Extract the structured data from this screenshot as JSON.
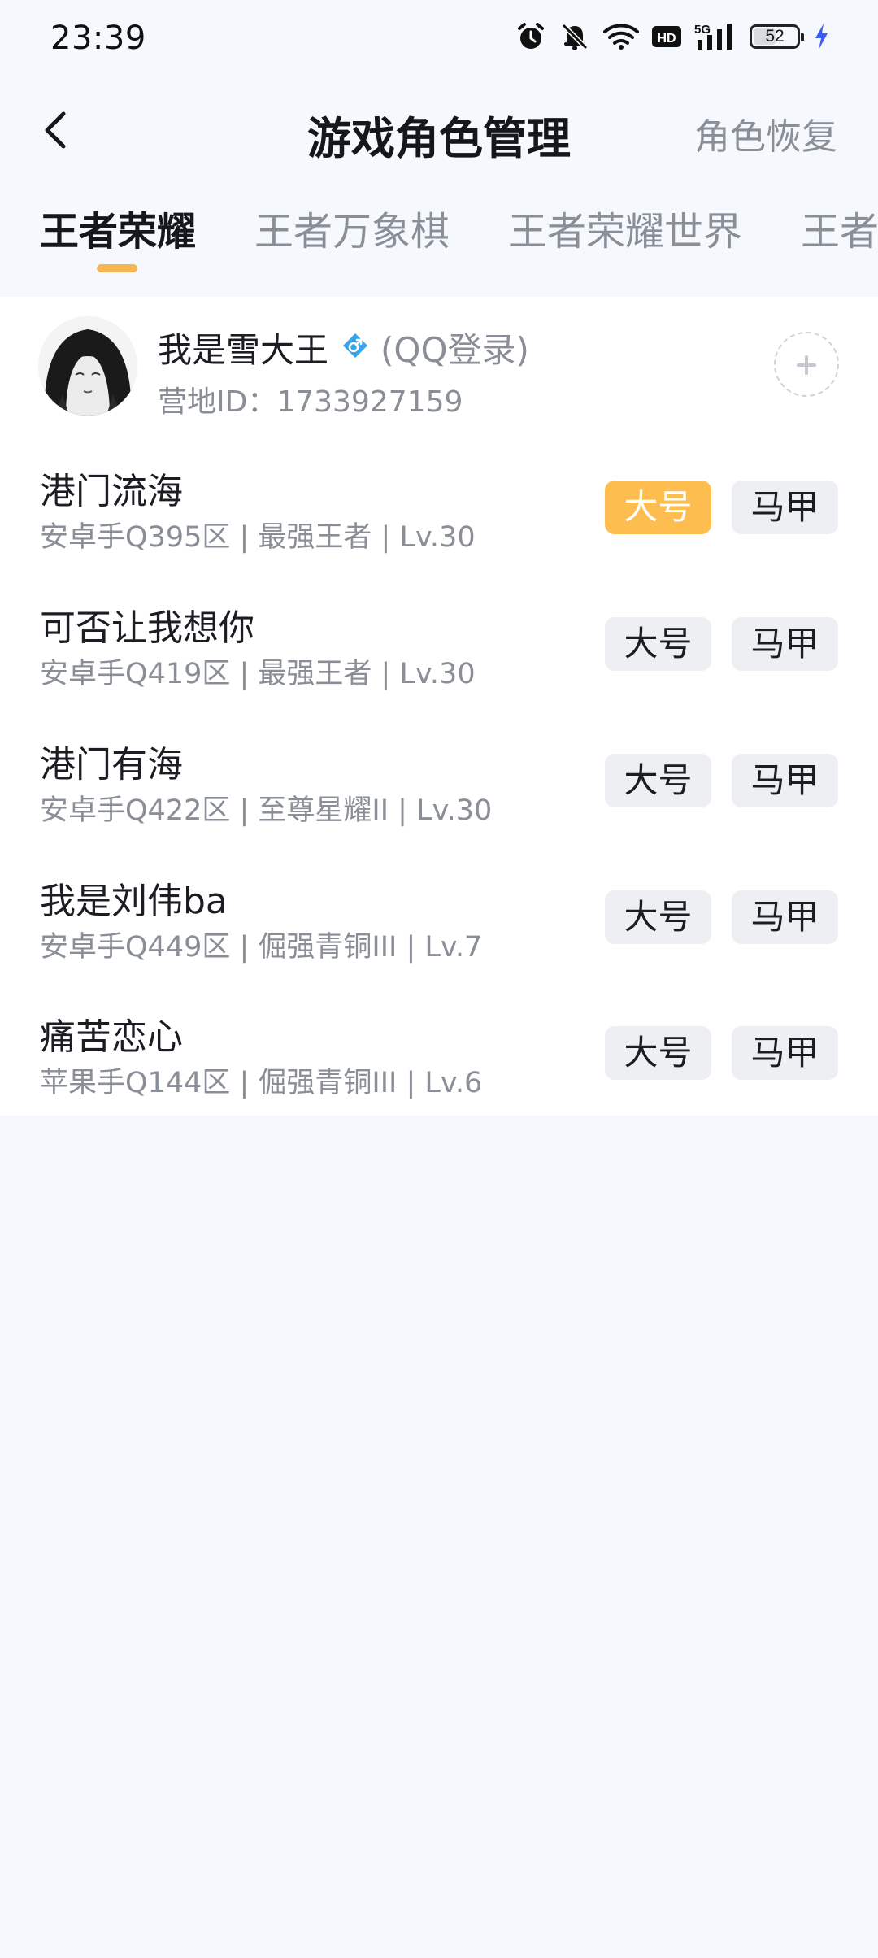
{
  "status_bar": {
    "time": "23:39",
    "icons": [
      "alarm-icon",
      "bell-muted-icon",
      "wifi-icon",
      "hd-icon",
      "5g-signal-icon",
      "battery-icon",
      "charging-bolt-icon"
    ],
    "network_label": "5G",
    "hd_label": "HD",
    "battery_level": 52,
    "battery_text": "52"
  },
  "header": {
    "back_icon": "chevron-left-icon",
    "title": "游戏角色管理",
    "restore_label": "角色恢复"
  },
  "tabs": [
    {
      "label": "王者荣耀",
      "active": true
    },
    {
      "label": "王者万象棋",
      "active": false
    },
    {
      "label": "王者荣耀世界",
      "active": false
    },
    {
      "label": "王者",
      "active": false
    }
  ],
  "colors": {
    "accent": "#f9b552",
    "selected_button": "#fdbd4f",
    "gender_icon": "#3aa4e8",
    "page_background": "#f5f8fd"
  },
  "account": {
    "name": "我是雪大王",
    "gender_icon": "male-icon",
    "login_type": "(QQ登录)",
    "camp_id": "营地ID：1733927159",
    "add_icon": "plus-icon"
  },
  "buttons": {
    "main": "大号",
    "alt": "马甲"
  },
  "roles": [
    {
      "name": "港门流海",
      "info": "安卓手Q395区 | 最强王者 | Lv.30",
      "main_selected": true
    },
    {
      "name": "可否让我想你",
      "info": "安卓手Q419区 | 最强王者 | Lv.30",
      "main_selected": false
    },
    {
      "name": "港门有海",
      "info": "安卓手Q422区 | 至尊星耀II | Lv.30",
      "main_selected": false
    },
    {
      "name": "我是刘伟ba",
      "info": "安卓手Q449区 | 倔强青铜III | Lv.7",
      "main_selected": false
    },
    {
      "name": "痛苦恋心",
      "info": "苹果手Q144区 | 倔强青铜III | Lv.6",
      "main_selected": false
    }
  ]
}
